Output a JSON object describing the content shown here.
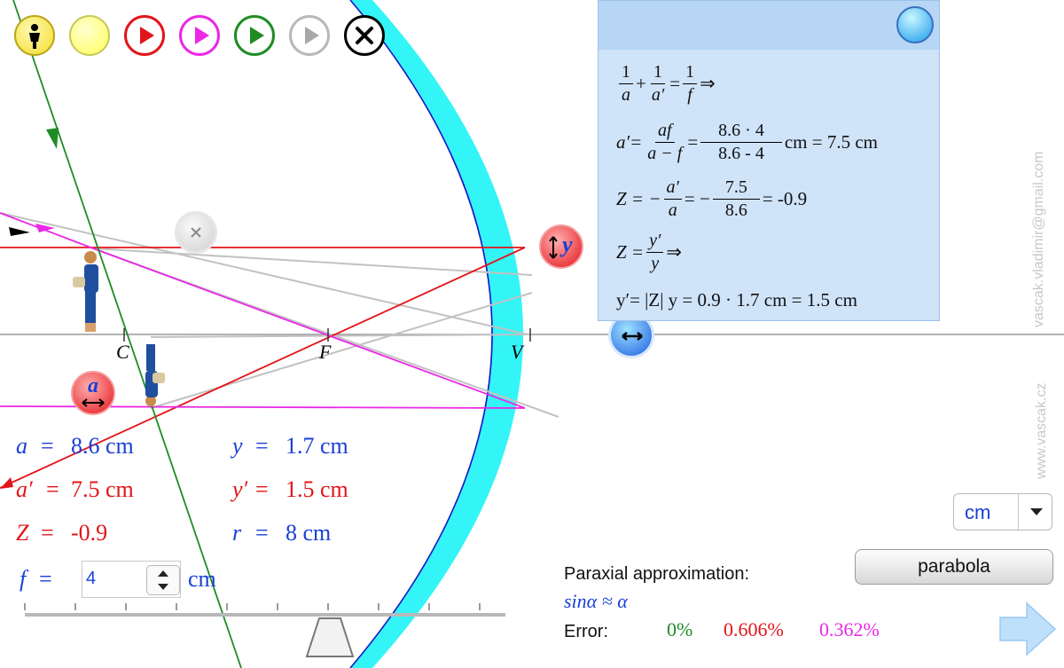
{
  "toolbar": {
    "buttons": [
      {
        "name": "person-button",
        "icon": "person-icon",
        "color": "#f5e24a"
      },
      {
        "name": "yellow-button",
        "icon": "yellow-circle-icon",
        "color": "#ffff66"
      },
      {
        "name": "play-red-button",
        "icon": "play-icon",
        "color": "#e3141a"
      },
      {
        "name": "play-magenta-button",
        "icon": "play-icon",
        "color": "#ea28e6"
      },
      {
        "name": "play-green-button",
        "icon": "play-icon",
        "color": "#1f8c24"
      },
      {
        "name": "play-gray-button",
        "icon": "play-icon",
        "color": "#a8a8a8"
      },
      {
        "name": "close-button",
        "icon": "close-icon",
        "color": "#000000"
      }
    ]
  },
  "diagram": {
    "point_c": "C",
    "point_f": "F",
    "point_v": "V",
    "a_handle": "a",
    "y_handle": "y"
  },
  "values": {
    "a_label": "a",
    "a_value": "8.6 cm",
    "a_prime_label": "a′",
    "a_prime_value": "7.5 cm",
    "z_label": "Z",
    "z_value": "-0.9",
    "y_label": "y",
    "y_value": "1.7 cm",
    "y_prime_label": "y′",
    "y_prime_value": "1.5 cm",
    "r_label": "r",
    "r_value": "8 cm",
    "eq_sign": "=",
    "f_label": "f",
    "f_input": "4",
    "f_unit": "cm"
  },
  "formulas": {
    "l1_n1": "1",
    "l1_d1": "a",
    "l1_n2": "1",
    "l1_d2": "a′",
    "l1_n3": "1",
    "l1_d3": "f",
    "l1_tail": "⇒",
    "l2_lhs": "a′=",
    "l2_n1": "af",
    "l2_d1": "a − f",
    "l2_n2": "8.6 · 4",
    "l2_d2": "8.6 - 4",
    "l2_tail": "cm = 7.5 cm",
    "l3_lhs": "Z = −",
    "l3_n1": "a′",
    "l3_d1": "a",
    "l3_mid": "= −",
    "l3_n2": "7.5",
    "l3_d2": "8.6",
    "l3_tail": "= -0.9",
    "l4_lhs": "Z =",
    "l4_n1": "y′",
    "l4_d1": "y",
    "l4_tail": "⇒",
    "l5": "y′= |Z| y = 0.9 · 1.7 cm = 1.5 cm"
  },
  "units": {
    "selected": "cm"
  },
  "parabola_button": "parabola",
  "paraxial": {
    "title": "Paraxial approximation:",
    "formula": "sinα ≈ α",
    "error_label": "Error:",
    "err_green": "0%",
    "err_red": "0.606%",
    "err_magenta": "0.362%"
  },
  "watermark": {
    "email": "vascak.vladimir@gmail.com",
    "site": "www.vascak.cz"
  },
  "colors": {
    "red_ray": "#e3141a",
    "magenta_ray": "#ea28e6",
    "green_ray": "#1f8c24",
    "gray_ray": "#bdbdbd",
    "mirror": "#33f5f7",
    "values_blue": "#1a3fd6"
  }
}
